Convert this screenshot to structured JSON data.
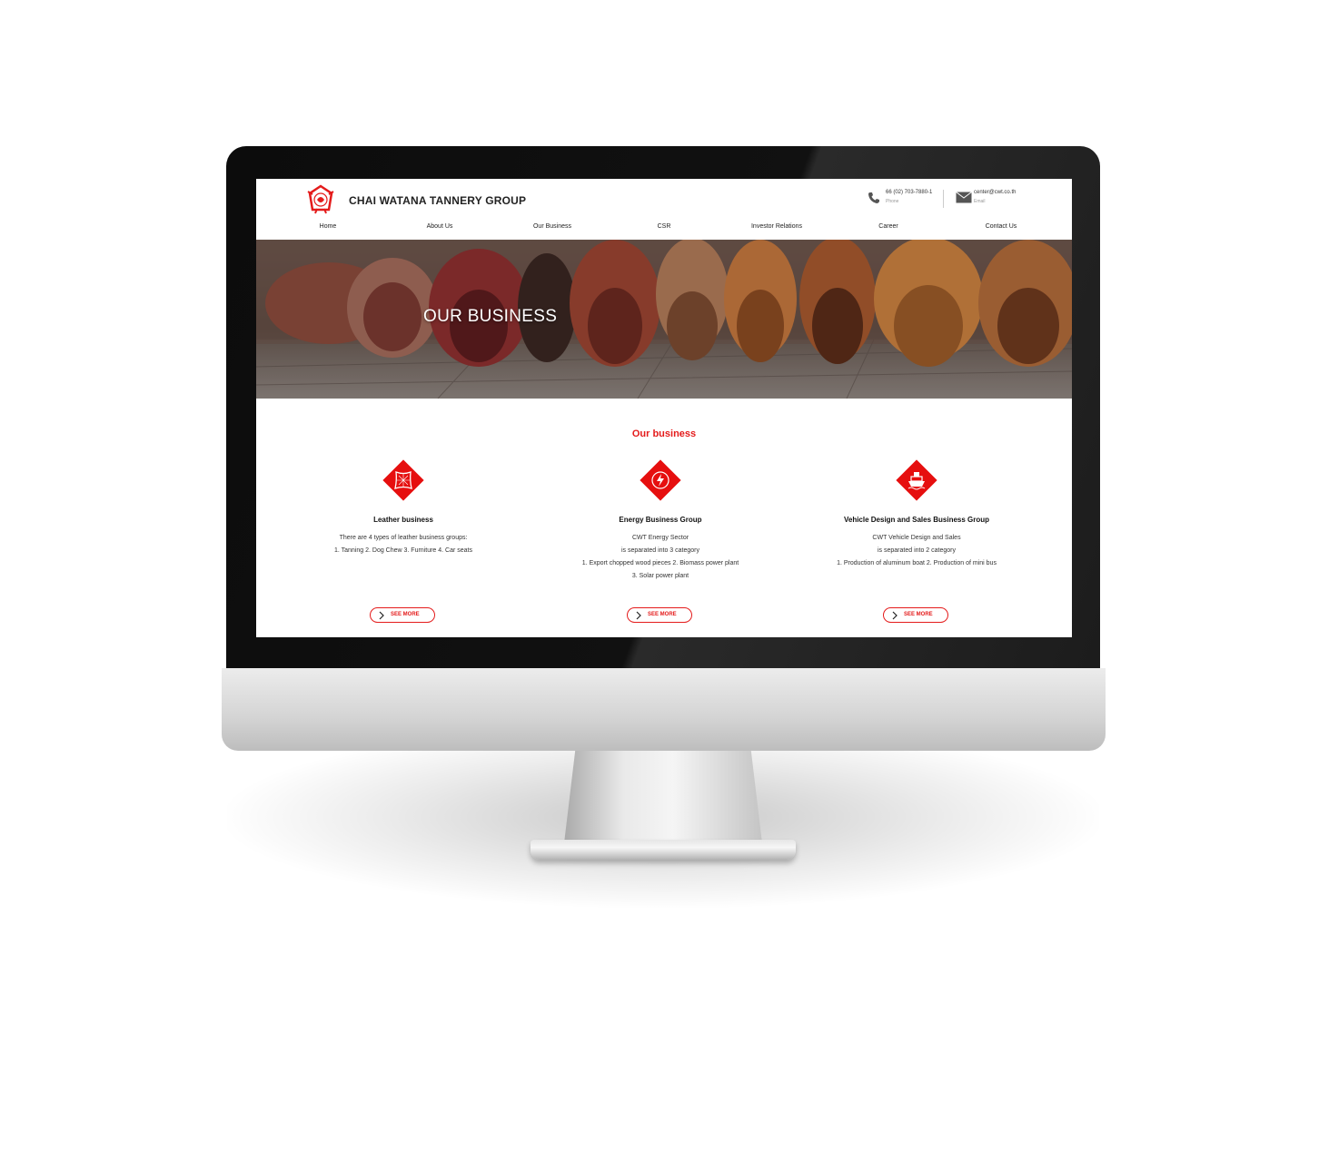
{
  "brand": {
    "name": "CHAI WATANA TANNERY GROUP",
    "logo_icon": "cwt-logo-icon",
    "accent_color": "#e41b1b"
  },
  "contact": {
    "phone": {
      "value": "66 (02) 703-7880-1",
      "label": "Phone",
      "icon": "phone-icon"
    },
    "email": {
      "value": "center@cwt.co.th",
      "label": "Email",
      "icon": "mail-icon"
    }
  },
  "nav": {
    "items": [
      {
        "label": "Home"
      },
      {
        "label": "About Us"
      },
      {
        "label": "Our Business"
      },
      {
        "label": "CSR"
      },
      {
        "label": "Investor Relations"
      },
      {
        "label": "Career"
      },
      {
        "label": "Contact Us"
      }
    ]
  },
  "hero": {
    "title": "OUR BUSINESS"
  },
  "section": {
    "title": "Our business"
  },
  "businesses": [
    {
      "icon": "leather-hide-icon",
      "title": "Leather business",
      "lines": [
        "There are 4 types of leather business groups:",
        "1. Tanning 2. Dog Chew 3. Furniture 4. Car seats"
      ],
      "button": "SEE MORE"
    },
    {
      "icon": "energy-bolt-icon",
      "title": "Energy Business Group",
      "lines": [
        "CWT Energy Sector",
        "is separated into 3 category",
        "1. Export chopped wood pieces 2. Biomass power plant",
        "3. Solar power plant"
      ],
      "button": "SEE MORE"
    },
    {
      "icon": "boat-icon",
      "title": "Vehicle Design and Sales Business Group",
      "lines": [
        "CWT Vehicle Design and Sales",
        "is separated into 2 category",
        "1. Production of aluminum boat 2. Production of mini bus"
      ],
      "button": "SEE MORE"
    }
  ]
}
